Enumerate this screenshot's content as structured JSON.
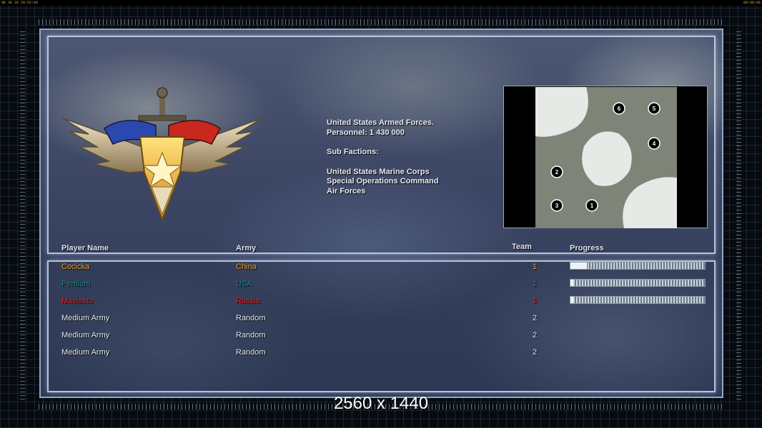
{
  "statusbar": {
    "left": "UK 30 32 20:52:06",
    "right": "00:00:00"
  },
  "faction": {
    "title": "United States Armed Forces.",
    "personnel": "Personnel: 1 430 000",
    "subfactions_label": "Sub Factions:",
    "subfactions": [
      "United States Marine Corps",
      "Special Operations Command",
      "Air Forces"
    ]
  },
  "minimap": {
    "start_positions": [
      "1",
      "2",
      "3",
      "4",
      "5",
      "6"
    ]
  },
  "table": {
    "headers": {
      "name": "Player Name",
      "army": "Army",
      "team": "Team",
      "progress": "Progress"
    },
    "rows": [
      {
        "name": "Cocicka",
        "army": "China",
        "team": "1",
        "progress": 0.12,
        "color": "#e8a020"
      },
      {
        "name": "Pentium",
        "army": "USA",
        "team": "1",
        "progress": 0.02,
        "color": "#1d8a8a"
      },
      {
        "name": "Maviesto",
        "army": "Russia",
        "team": "1",
        "progress": 0.02,
        "color": "#e8201c"
      },
      {
        "name": "Medium Army",
        "army": "Random",
        "team": "2",
        "progress": null,
        "color": "#e6e9ef"
      },
      {
        "name": "Medium Army",
        "army": "Random",
        "team": "2",
        "progress": null,
        "color": "#e6e9ef"
      },
      {
        "name": "Medium Army",
        "army": "Random",
        "team": "2",
        "progress": null,
        "color": "#e6e9ef"
      }
    ]
  },
  "watermark": "2560 x 1440"
}
